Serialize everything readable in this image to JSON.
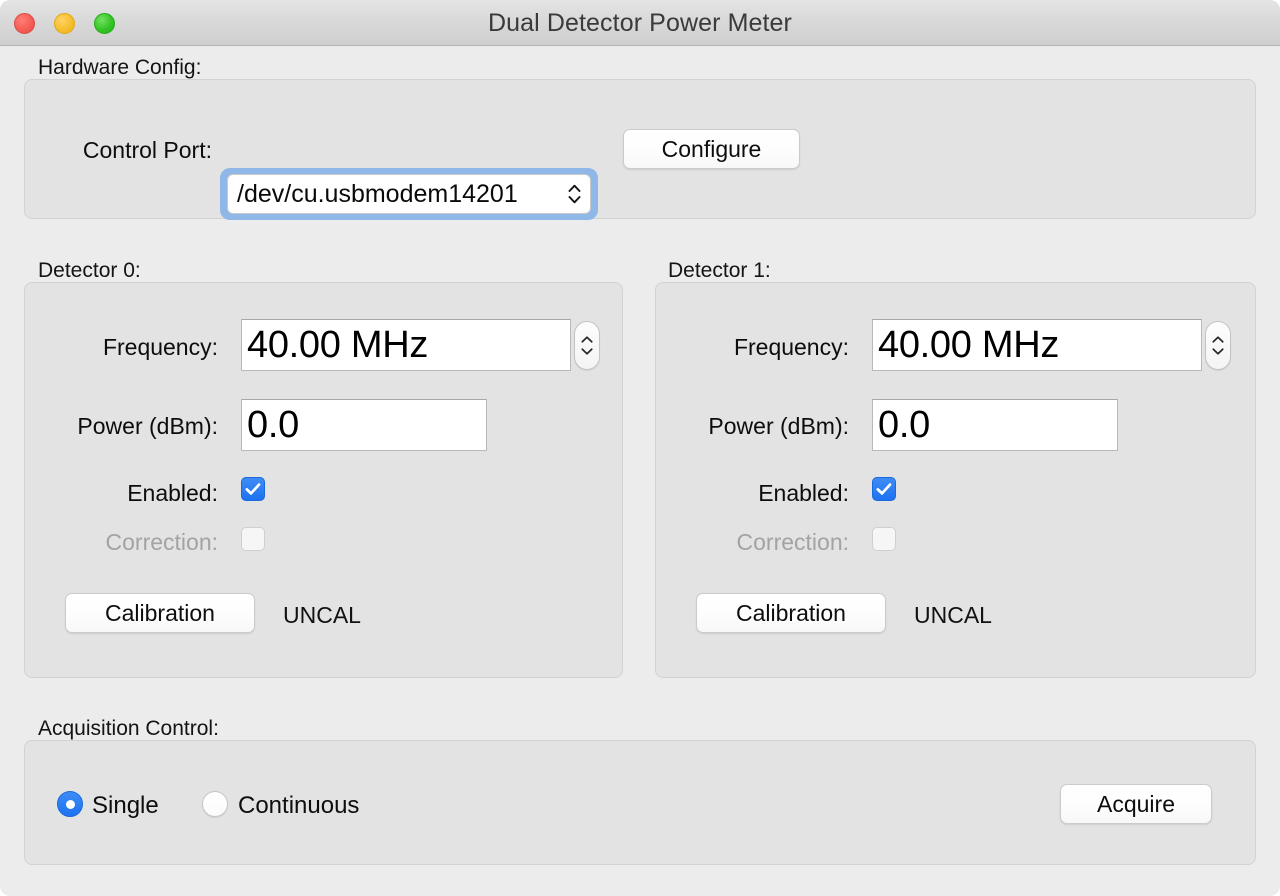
{
  "window": {
    "title": "Dual Detector Power Meter",
    "traffic_lights": [
      "close-button",
      "minimize-button",
      "maximize-button"
    ],
    "accent_blue": "#1d72f0",
    "focus_ring_blue": "#8fb8e8"
  },
  "hardware": {
    "section_label": "Hardware Config:",
    "port_label": "Control Port:",
    "port_value": "/dev/cu.usbmodem14201",
    "configure_label": "Configure"
  },
  "detectors": [
    {
      "section_label": "Detector 0:",
      "frequency_label": "Frequency:",
      "frequency_value": "40.00 MHz",
      "power_label": "Power (dBm):",
      "power_value": "0.0",
      "enabled_label": "Enabled:",
      "enabled_checked": true,
      "correction_label": "Correction:",
      "correction_checked": false,
      "correction_disabled": true,
      "calibration_label": "Calibration",
      "cal_status": "UNCAL"
    },
    {
      "section_label": "Detector 1:",
      "frequency_label": "Frequency:",
      "frequency_value": "40.00 MHz",
      "power_label": "Power (dBm):",
      "power_value": "0.0",
      "enabled_label": "Enabled:",
      "enabled_checked": true,
      "correction_label": "Correction:",
      "correction_checked": false,
      "correction_disabled": true,
      "calibration_label": "Calibration",
      "cal_status": "UNCAL"
    }
  ],
  "acquisition": {
    "section_label": "Acquisition Control:",
    "mode_single_label": "Single",
    "mode_continuous_label": "Continuous",
    "selected_mode": "Single",
    "acquire_label": "Acquire"
  }
}
